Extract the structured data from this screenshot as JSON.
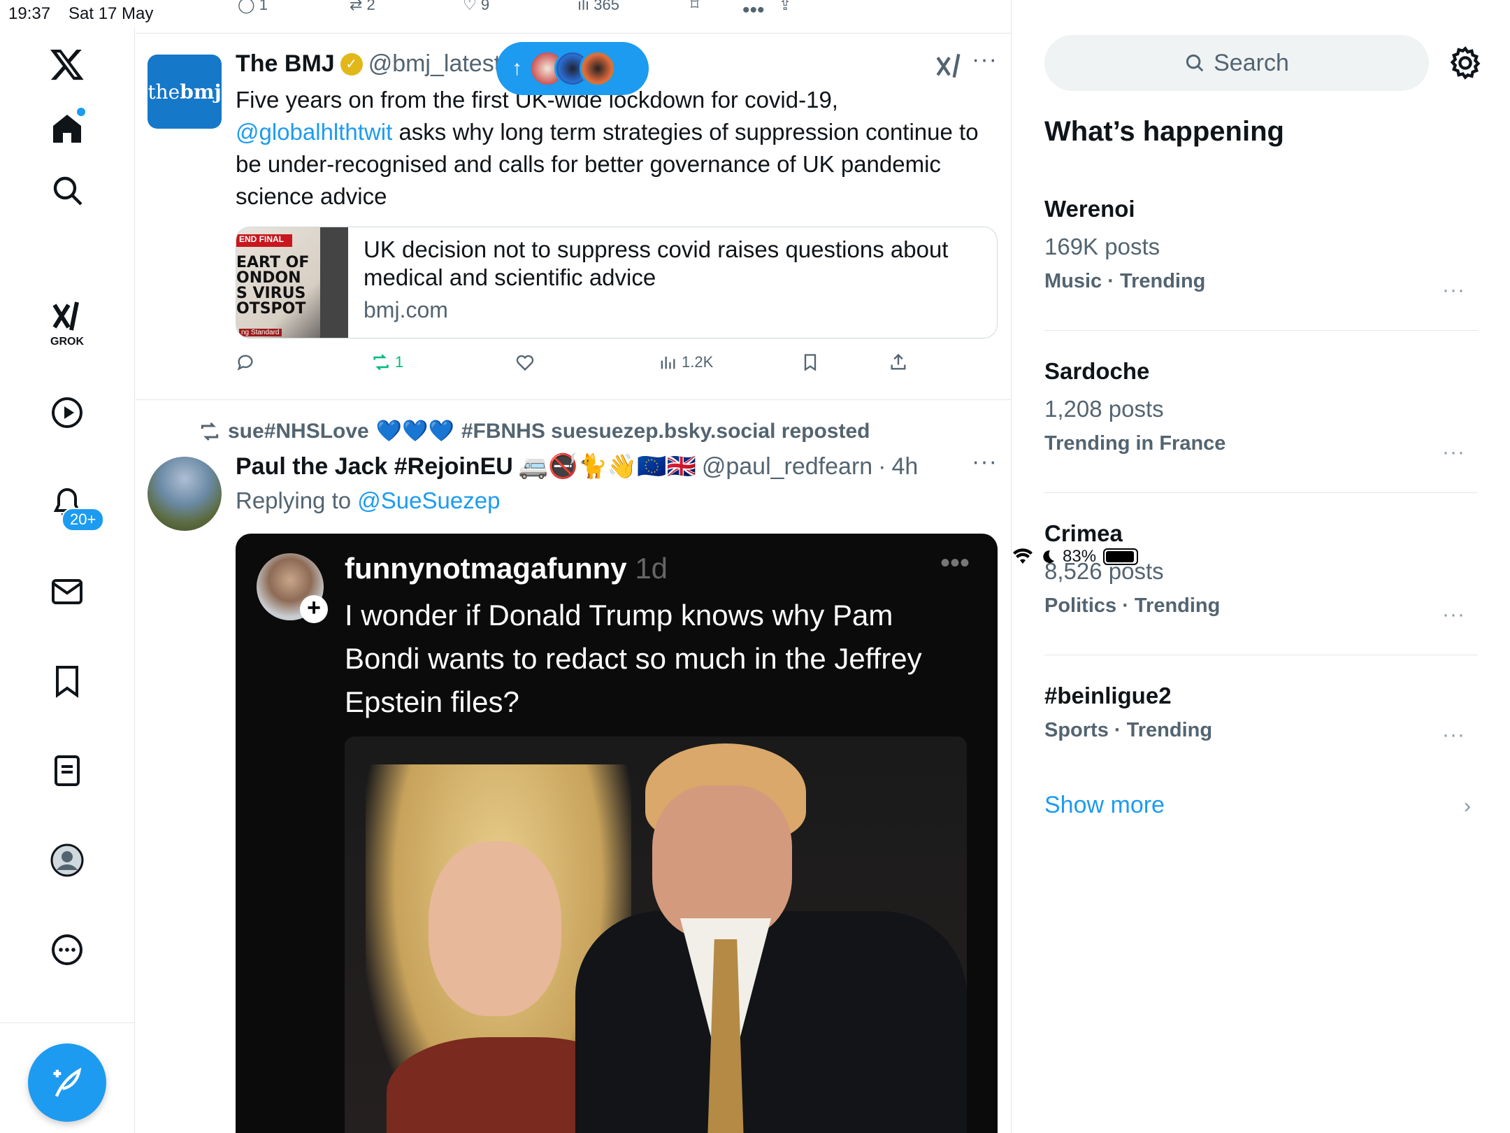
{
  "status_bar": {
    "time": "19:37",
    "date": "Sat 17 May",
    "battery": "83%",
    "battery_level": 0.83
  },
  "sidebar": {
    "grok_label": "GROK",
    "notifications_badge": "20+"
  },
  "prev_tweet_actions": {
    "replies": "1",
    "reposts": "2",
    "likes": "9",
    "views": "365"
  },
  "tweet1": {
    "avatar_text_light": "the",
    "avatar_text_bold": "bmj",
    "name": "The BMJ",
    "handle": "@bmj_latest",
    "body_before": "Five years on from the first UK-wide lockdown for covid-19,",
    "body_mention": "@globalhlthtwit",
    "body_after": " asks why long term strategies of suppression continue to be under-recognised and calls for better governance of UK pandemic science advice",
    "card": {
      "title": "UK decision not to suppress covid raises questions about medical and scientific advice",
      "domain": "bmj.com",
      "image_header": "END FINAL",
      "image_text": "EART OF\nONDON\nS VIRUS\nOTSPOT",
      "image_footer": "ng Standard"
    },
    "actions": {
      "replies": "",
      "reposts": "1",
      "likes": "",
      "views": "1.2K"
    }
  },
  "pill": {
    "arrow": "↑"
  },
  "tweet2": {
    "repost_user": "sue#NHSLove",
    "repost_hearts": "💙💙💙",
    "repost_rest": "#FBNHS suesuezep.bsky.social reposted",
    "name": "Paul the Jack #RejoinEU",
    "name_emojis": "🚐🚭🐈👋🇪🇺🇬🇧",
    "handle": "@paul_redfearn",
    "time": "4h",
    "replying_label": "Replying to",
    "replying_to": "@SueSuezep",
    "media": {
      "user": "funnynotmagafunny",
      "ago": "1d",
      "text": "I wonder if Donald Trump knows why Pam Bondi wants to redact so much in the Jeffrey Epstein files?"
    }
  },
  "right_panel": {
    "search_placeholder": "Search",
    "title": "What’s happening",
    "trends": [
      {
        "name": "Werenoi",
        "count": "169K posts",
        "category": "Music · Trending"
      },
      {
        "name": "Sardoche",
        "count": "1,208 posts",
        "category": "Trending in France"
      },
      {
        "name": "Crimea",
        "count": "8,526 posts",
        "category": "Politics · Trending"
      },
      {
        "name": "#beinligue2",
        "count": "",
        "category": "Sports · Trending"
      }
    ],
    "show_more": "Show more"
  },
  "colors": {
    "accent": "#1d9bf0",
    "secondary_text": "#536471",
    "repost_green": "#00ba7c",
    "bmj_blue": "#1578c8"
  }
}
